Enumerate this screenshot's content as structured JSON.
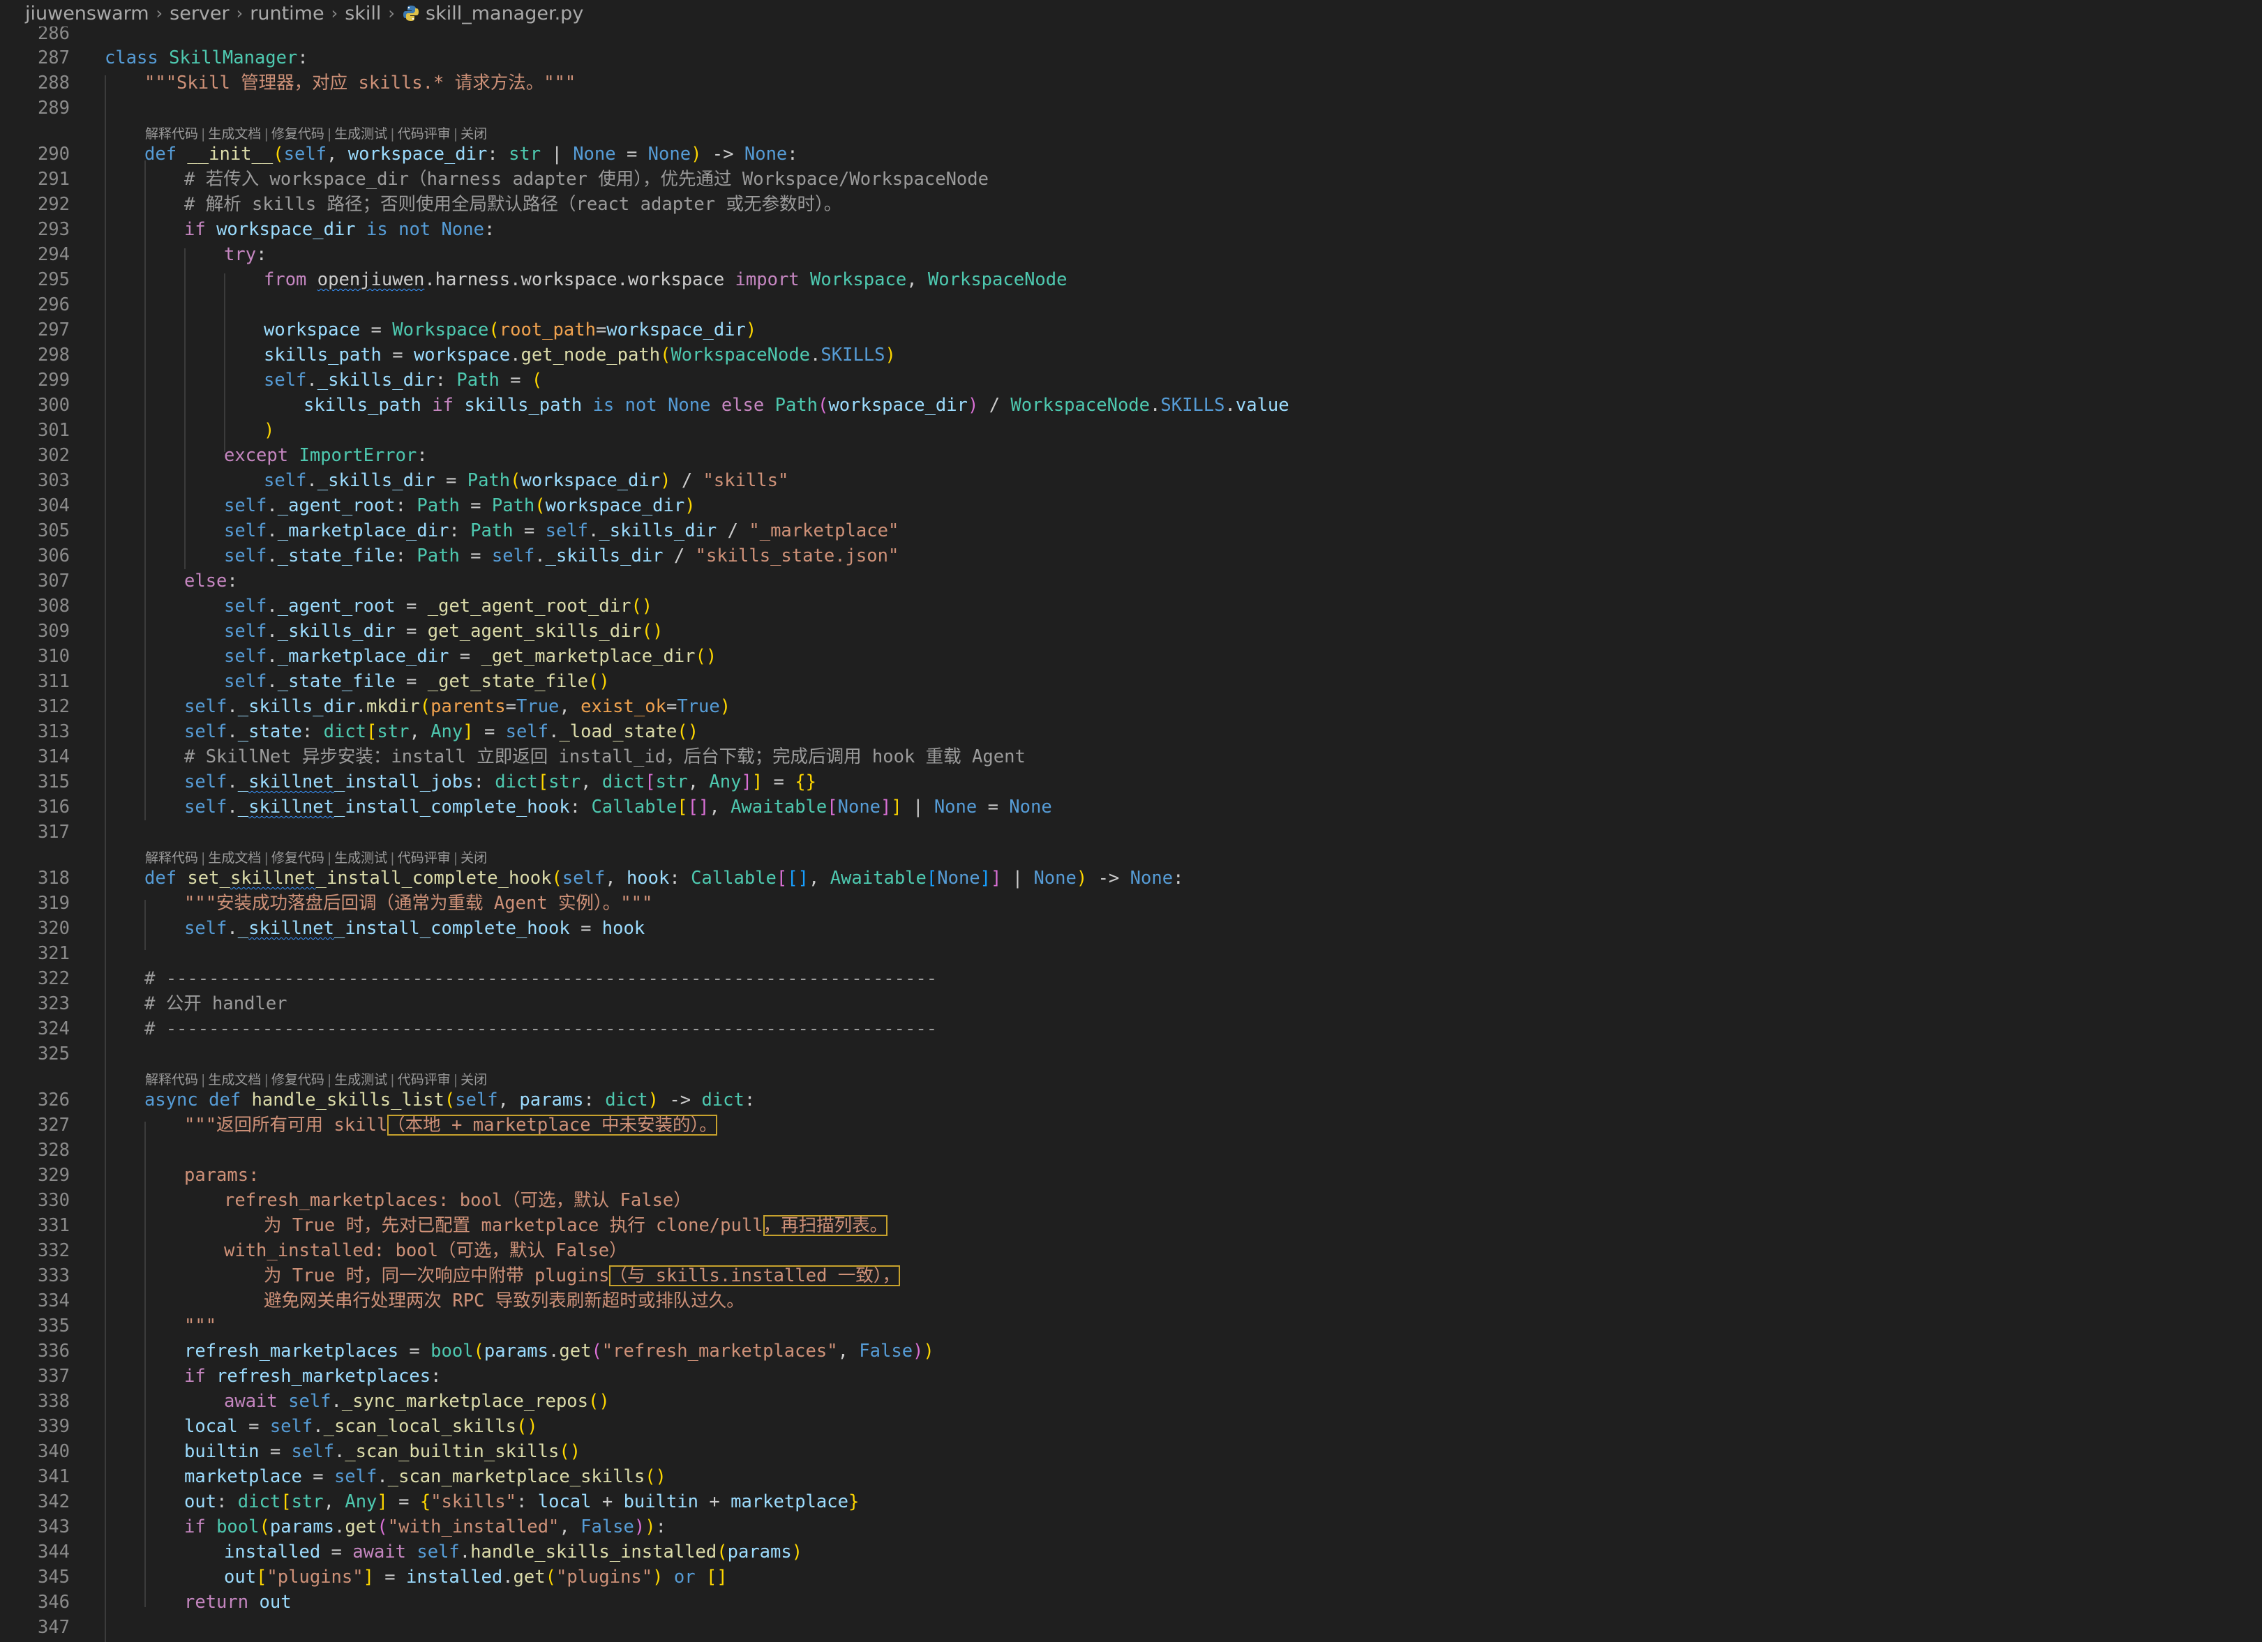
{
  "breadcrumb": {
    "items": [
      "jiuwenswarm",
      "server",
      "runtime",
      "skill"
    ],
    "file": "skill_manager.py"
  },
  "codelens": {
    "items": [
      "解释代码",
      "生成文档",
      "修复代码",
      "生成测试",
      "代码评审",
      "关闭"
    ]
  },
  "line_numbers": [
    "286",
    "287",
    "288",
    "289",
    "290",
    "291",
    "292",
    "293",
    "294",
    "295",
    "296",
    "297",
    "298",
    "299",
    "300",
    "301",
    "302",
    "303",
    "304",
    "305",
    "306",
    "307",
    "308",
    "309",
    "310",
    "311",
    "312",
    "313",
    "314",
    "315",
    "316",
    "317",
    "318",
    "319",
    "320",
    "321",
    "322",
    "323",
    "324",
    "325",
    "326",
    "327",
    "328",
    "329",
    "330",
    "331",
    "332",
    "333",
    "334",
    "335",
    "336",
    "337",
    "338",
    "339",
    "340",
    "341",
    "342",
    "343",
    "344",
    "345",
    "346",
    "347"
  ],
  "code_text": {
    "l287": "class SkillManager:",
    "l288": "\"\"\"Skill 管理器，对应 skills.* 请求方法。\"\"\"",
    "l291": "# 若传入 workspace_dir（harness adapter 使用），优先通过 Workspace/WorkspaceNode",
    "l292": "# 解析 skills 路径；否则使用全局默认路径（react adapter 或无参数时）。",
    "l314": "# SkillNet 异步安装：install 立即返回 install_id，后台下载；完成后调用 hook 重载 Agent",
    "l319": "\"\"\"安装成功落盘后回调（通常为重载 Agent 实例）。\"\"\"",
    "l322": "# ------------------------------------------------------------------------",
    "l323": "# 公开 handler",
    "l324": "# ------------------------------------------------------------------------",
    "l327a": "\"\"\"返回所有可用 skill",
    "l327b": "（本地 + marketplace 中未安装的）。",
    "l329": "params:",
    "l330": "refresh_marketplaces: bool（可选，默认 False）",
    "l331a": "为 True 时，先对已配置 marketplace 执行 clone/pull",
    "l331b": "，再扫描列表。",
    "l332": "with_installed: bool（可选，默认 False）",
    "l333a": "为 True 时，同一次响应中附带 plugins",
    "l333b": "（与 skills.installed 一致），",
    "l334": "避免网关串行处理两次 RPC 导致列表刷新超时或排队过久。",
    "l335": "\"\"\""
  }
}
